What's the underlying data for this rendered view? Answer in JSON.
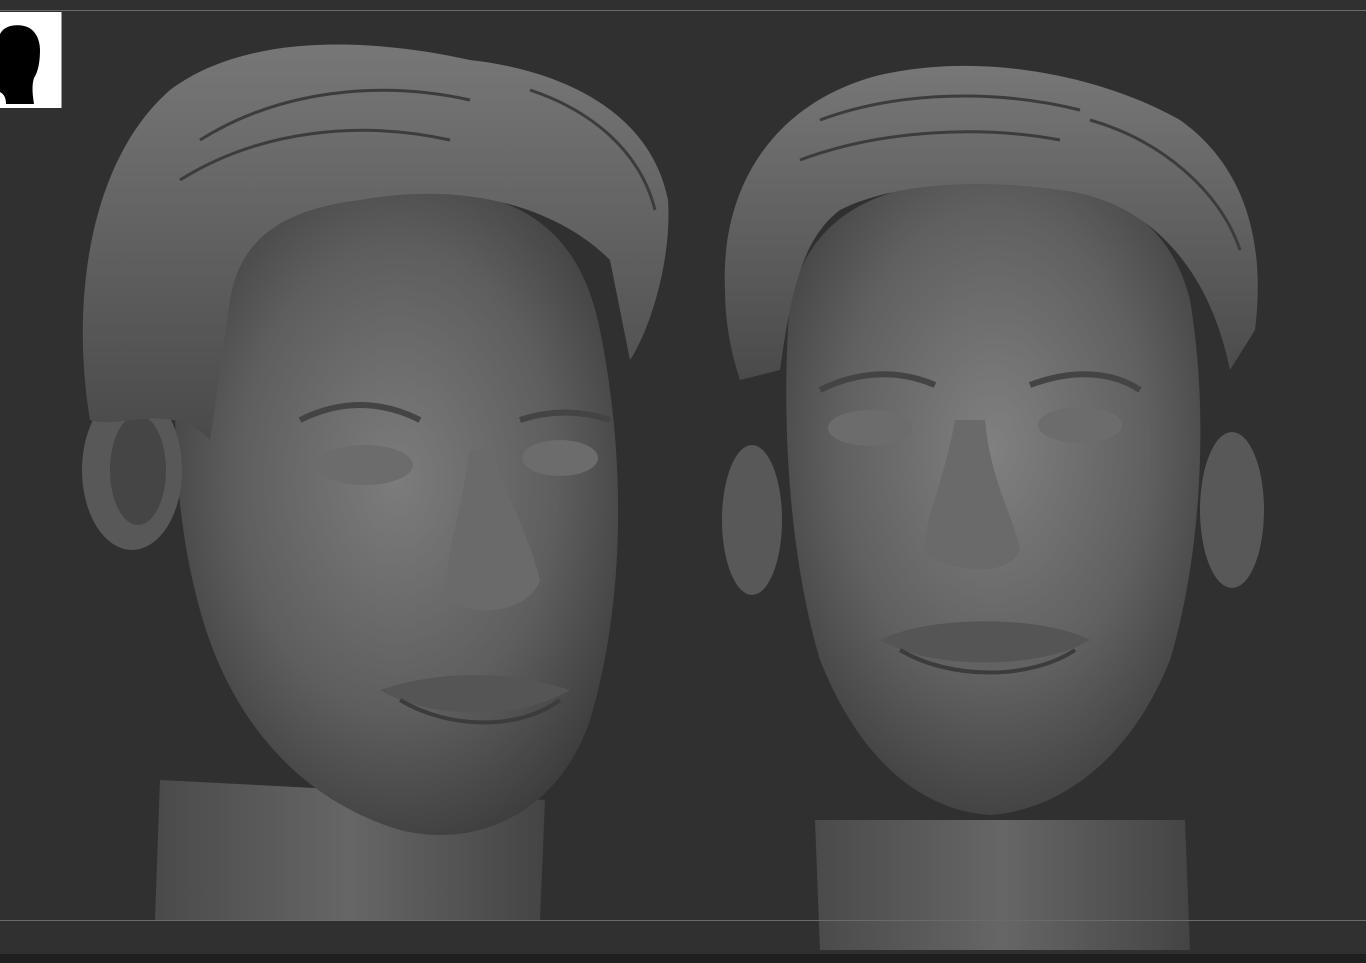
{
  "viewport": {
    "background": "#303030",
    "guide_color": "#6a6a6a"
  },
  "navigator": {
    "icon": "head-silhouette-icon",
    "background": "#ffffff",
    "silhouette_color": "#000000"
  },
  "sculpt": {
    "material_color": "#5a5a5a",
    "views": [
      "three-quarter-view",
      "front-view"
    ]
  }
}
